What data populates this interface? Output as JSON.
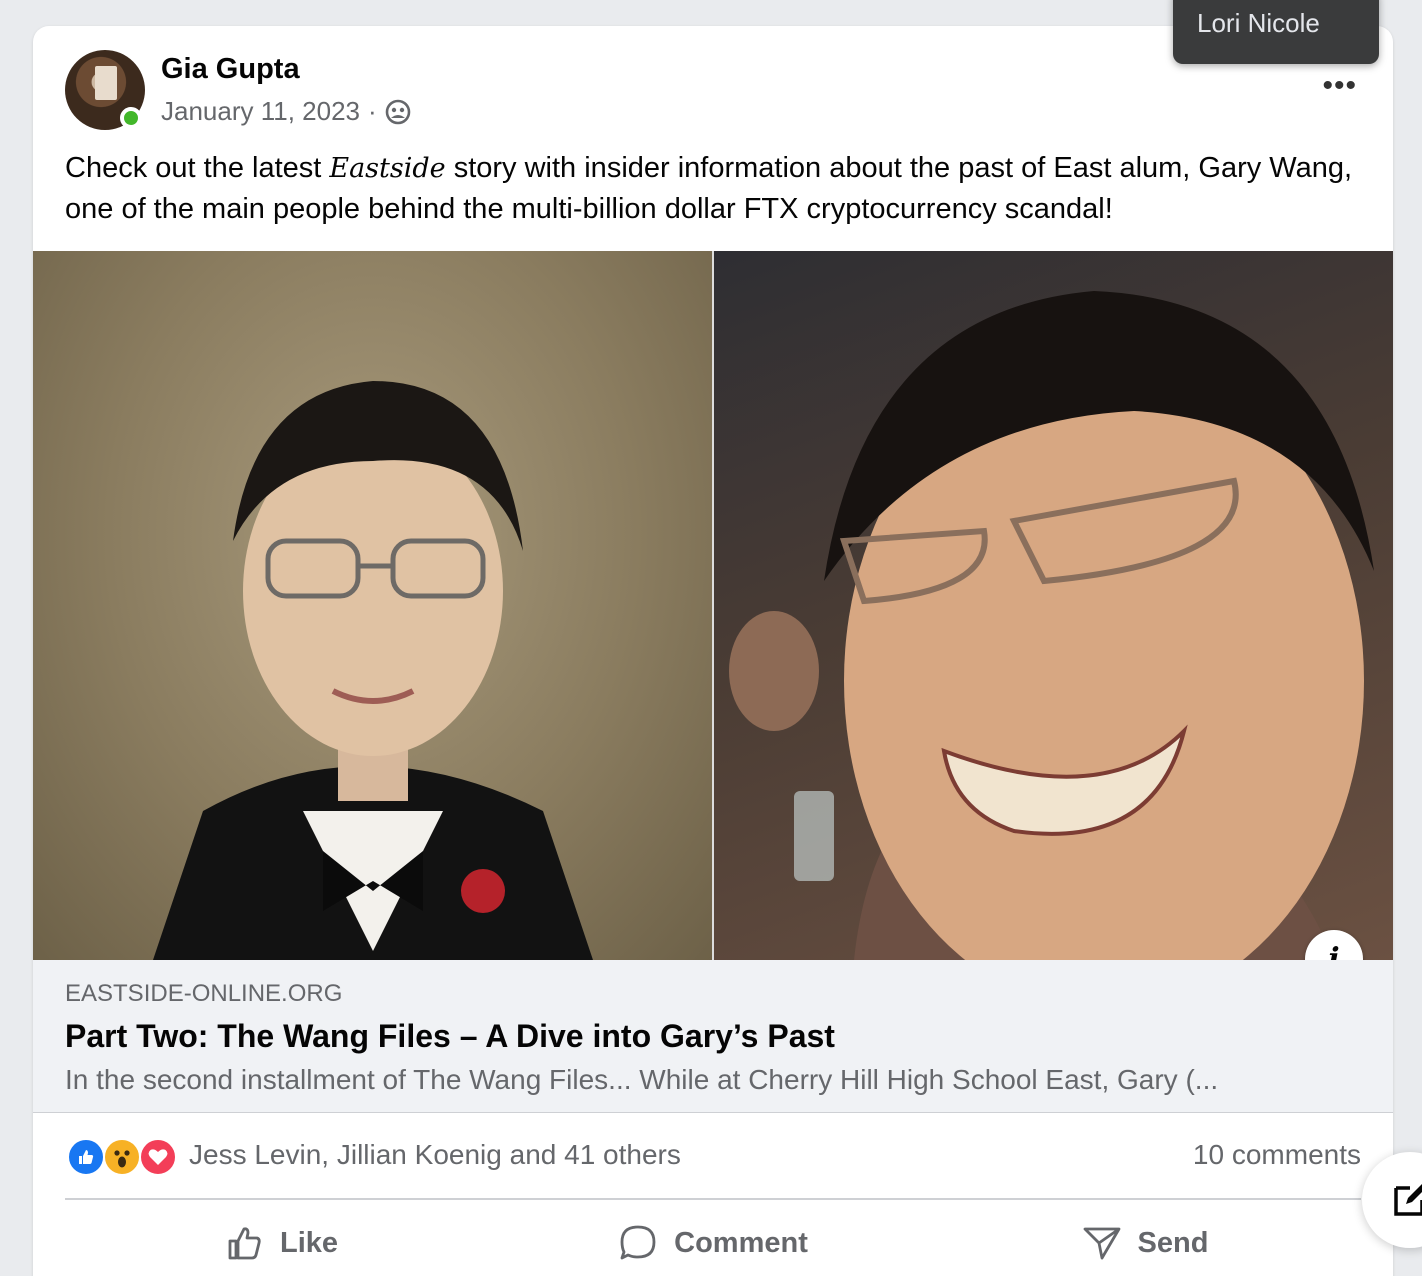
{
  "post": {
    "author": "Gia Gupta",
    "date": "January 11, 2023",
    "separator": "·",
    "caption_before": "Check out the latest ",
    "caption_em": "Eastside",
    "caption_after": " story with insider information about the past of East alum, Gary Wang, one of the main people behind the multi-billion dollar FTX cryptocurrency scandal!",
    "privacy_icon": "friends-icon",
    "menu_icon": "more-horizontal-icon"
  },
  "link_preview": {
    "domain": "EASTSIDE-ONLINE.ORG",
    "title": "Part Two: The Wang Files – A Dive into Gary’s Past",
    "description": "In the second installment of The Wang Files... While at Cherry Hill High School East, Gary (..."
  },
  "engagement": {
    "reactions": [
      "like",
      "wow",
      "love"
    ],
    "reactors_text": "Jess Levin, Jillian Koenig and 41 others",
    "comments_text": "10 comments"
  },
  "actions": {
    "like": "Like",
    "comment": "Comment",
    "send": "Send"
  },
  "tooltip": {
    "text": "Lori Nicole"
  },
  "colors": {
    "like_blue": "#1877f2",
    "wow_yellow": "#f7b125",
    "love_red": "#f33e58",
    "online_green": "#42b72a",
    "secondary_text": "#65676b"
  }
}
